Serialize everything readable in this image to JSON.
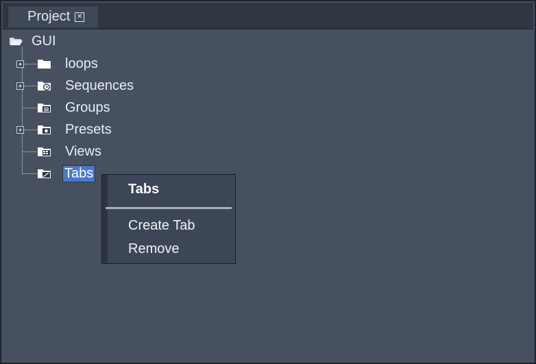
{
  "tab": {
    "title": "Project",
    "close_glyph": "✕"
  },
  "tree": {
    "root": {
      "label": "GUI",
      "icon": "folder-open-icon"
    },
    "items": [
      {
        "label": "loops",
        "icon": "folder-icon",
        "expandable": true
      },
      {
        "label": "Sequences",
        "icon": "sequence-folder-icon",
        "expandable": true
      },
      {
        "label": "Groups",
        "icon": "groups-folder-icon",
        "expandable": false
      },
      {
        "label": "Presets",
        "icon": "presets-folder-icon",
        "expandable": true
      },
      {
        "label": "Views",
        "icon": "views-folder-icon",
        "expandable": false
      },
      {
        "label": "Tabs",
        "icon": "tabs-folder-icon",
        "expandable": false,
        "selected": true
      }
    ]
  },
  "context_menu": {
    "title": "Tabs",
    "items": [
      {
        "label": "Create Tab"
      },
      {
        "label": "Remove"
      }
    ]
  },
  "colors": {
    "panel_background": "#46505f",
    "tab_background": "#3f4857",
    "selection": "#4a78cf",
    "menu_background": "#3d4656",
    "text": "#e8eef4"
  }
}
